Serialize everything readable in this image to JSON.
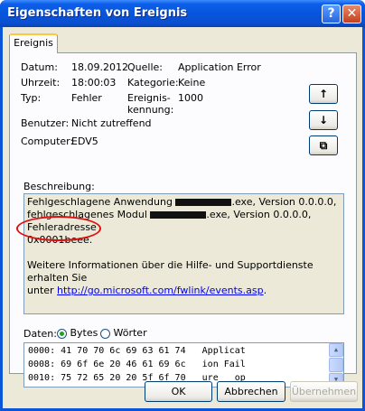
{
  "window": {
    "title": "Eigenschaften von Ereignis"
  },
  "titlebar": {
    "help_glyph": "?",
    "close_glyph": "✕"
  },
  "tab": {
    "label": "Ereignis"
  },
  "fields": {
    "datum_label": "Datum:",
    "datum_value": "18.09.2012",
    "uhrzeit_label": "Uhrzeit:",
    "uhrzeit_value": "18:00:03",
    "typ_label": "Typ:",
    "typ_value": "Fehler",
    "benutzer_label": "Benutzer:",
    "benutzer_value": "Nicht zutreffend",
    "computer_label": "Computer:",
    "computer_value": "EDV5",
    "quelle_label": "Quelle:",
    "quelle_value": "Application Error",
    "kategorie_label": "Kategorie:",
    "kategorie_value": "Keine",
    "ereignis_label_1": "Ereignis-",
    "ereignis_label_2": "kennung:",
    "ereignis_value": "1000"
  },
  "nav": {
    "up": "↑",
    "down": "↓",
    "copy": "⧉"
  },
  "description": {
    "label": "Beschreibung:",
    "line1_a": "Fehlgeschlagene Anwendung ",
    "line1_b": ".exe, Version 0.0.0.0,",
    "line2_a": "fehlgeschlagenes Modul ",
    "line2_b": ".exe, Version 0.0.0.0, Fehleradresse",
    "line3": "0x0001beee.",
    "more_1": "Weitere Informationen über die Hilfe- und Supportdienste erhalten Sie",
    "more_2_a": "unter ",
    "link": "http://go.microsoft.com/fwlink/events.asp",
    "more_2_b": "."
  },
  "data_section": {
    "label": "Daten:",
    "option_bytes": "Bytes",
    "option_words": "Wörter",
    "selected": "Bytes",
    "rows": [
      "0000: 41 70 70 6c 69 63 61 74   Applicat",
      "0008: 69 6f 6e 20 46 61 69 6c   ion Fail",
      "0010: 75 72 65 20 20 5f 6f 70   ure  _op"
    ]
  },
  "buttons": {
    "ok": "OK",
    "cancel": "Abbrechen",
    "apply": "Übernehmen"
  }
}
